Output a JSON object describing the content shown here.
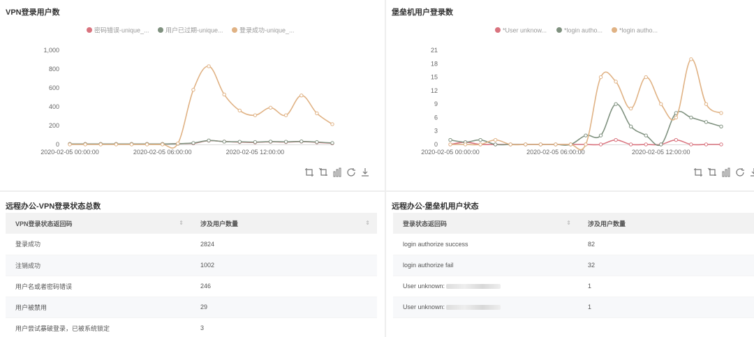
{
  "panels": {
    "vpn_chart_title": "VPN登录用户数",
    "bastion_chart_title": "堡垒机用户登录数",
    "vpn_table_title": "远程办公-VPN登录状态总数",
    "bastion_table_title": "远程办公-堡垒机用户状态"
  },
  "toolbox_icons": [
    "crop-icon",
    "crop-back-icon",
    "bar-chart-icon",
    "refresh-icon",
    "download-icon"
  ],
  "vpn_table": {
    "headers": [
      "VPN登录状态返回码",
      "涉及用户数量"
    ],
    "rows": [
      [
        "登录成功",
        "2824"
      ],
      [
        "注销成功",
        "1002"
      ],
      [
        "用户名或者密码错误",
        "246"
      ],
      [
        "用户被禁用",
        "29"
      ],
      [
        "用户尝试暴破登录，已被系统锁定",
        "3"
      ]
    ]
  },
  "bastion_table": {
    "headers": [
      "登录状态返回码",
      "涉及用户数量"
    ],
    "rows": [
      [
        "login authorize success",
        "82"
      ],
      [
        "login authorize fail",
        "32"
      ],
      [
        "User unknown:",
        "1"
      ],
      [
        "User unknown:",
        "1"
      ]
    ]
  },
  "chart_data": [
    {
      "type": "line",
      "title": "VPN登录用户数",
      "legend_position": "top-center",
      "ylim": [
        0,
        1000
      ],
      "y_ticks": [
        "1,000",
        "800",
        "600",
        "400",
        "200",
        "0"
      ],
      "x_tick_labels": [
        "2020-02-05 00:00:00",
        "2020-02-05 06:00:00",
        "2020-02-05 12:00:00"
      ],
      "x_tick_index": [
        0,
        6,
        12
      ],
      "x_count": 18,
      "grid": false,
      "series": [
        {
          "name": "密码错误-unique_...",
          "color": "#d9737e",
          "values": [
            5,
            5,
            5,
            5,
            5,
            5,
            5,
            8,
            12,
            40,
            30,
            25,
            22,
            28,
            25,
            30,
            22,
            12
          ]
        },
        {
          "name": "用户已过期-unique...",
          "color": "#7f917f",
          "values": [
            5,
            5,
            5,
            5,
            5,
            5,
            5,
            8,
            15,
            42,
            30,
            28,
            25,
            30,
            28,
            32,
            25,
            15
          ]
        },
        {
          "name": "登录成功-unique_...",
          "color": "#e0b284",
          "values": [
            0,
            0,
            0,
            0,
            0,
            0,
            0,
            10,
            580,
            830,
            530,
            360,
            310,
            390,
            310,
            520,
            330,
            215
          ]
        }
      ]
    },
    {
      "type": "line",
      "title": "堡垒机用户登录数",
      "legend_position": "top-center",
      "ylim": [
        0,
        21
      ],
      "y_ticks": [
        "21",
        "18",
        "15",
        "12",
        "9",
        "6",
        "3",
        "0"
      ],
      "x_tick_labels": [
        "2020-02-05 00:00:00",
        "2020-02-05 06:00:00",
        "2020-02-05 12:00:00"
      ],
      "x_tick_index": [
        0,
        7,
        14
      ],
      "x_count": 18,
      "grid": false,
      "series": [
        {
          "name": "*User unknow...",
          "color": "#d9737e",
          "values": [
            0,
            0.5,
            0,
            0,
            0,
            0,
            0,
            0,
            0,
            0,
            0,
            1,
            0,
            0,
            0,
            1,
            0,
            0,
            0
          ]
        },
        {
          "name": "*login autho...",
          "color": "#7f917f",
          "values": [
            1,
            0.5,
            1,
            0,
            0,
            0,
            0,
            0,
            0,
            2,
            2,
            9,
            4,
            2,
            0,
            7,
            6,
            5,
            4
          ]
        },
        {
          "name": "*login autho...",
          "color": "#e0b284",
          "values": [
            0,
            0,
            0,
            1,
            0,
            0,
            0,
            0,
            0,
            0,
            15,
            14,
            8,
            15,
            9,
            6,
            19,
            9,
            7
          ]
        }
      ]
    }
  ]
}
